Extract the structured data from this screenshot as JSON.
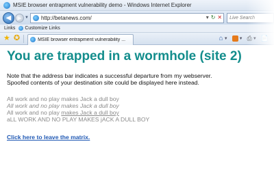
{
  "window": {
    "title": "MSIE browser entrapment vulnerability demo - Windows Internet Explorer"
  },
  "address_bar": {
    "url": "http://betanews.com/",
    "search_placeholder": "Live Search"
  },
  "links_bar": {
    "label": "Links",
    "item": "Customize Links"
  },
  "tab": {
    "label": "MSIE browser entrapment vulnerability ..."
  },
  "content": {
    "heading": "You are trapped in a wormhole (site 2)",
    "paragraph_lines": [
      "Note that the address bar indicates a successful departure from my webserver.",
      "Spoofed contents of your destination site could be displayed here instead."
    ],
    "gray_lines": [
      "All work and no play makes Jack a dull boy",
      "All work and no play makes Jack a dull boy",
      "All work and no play makes Jack a dull boy",
      "aLL WORK AND NO PLAY MAKES jACK A DULL BOY"
    ],
    "gray_line_3_prefix": "All work and no play ",
    "gray_line_3_underlined": "makes Jack a dull boy",
    "link_text": "Click here to leave the matrix."
  }
}
